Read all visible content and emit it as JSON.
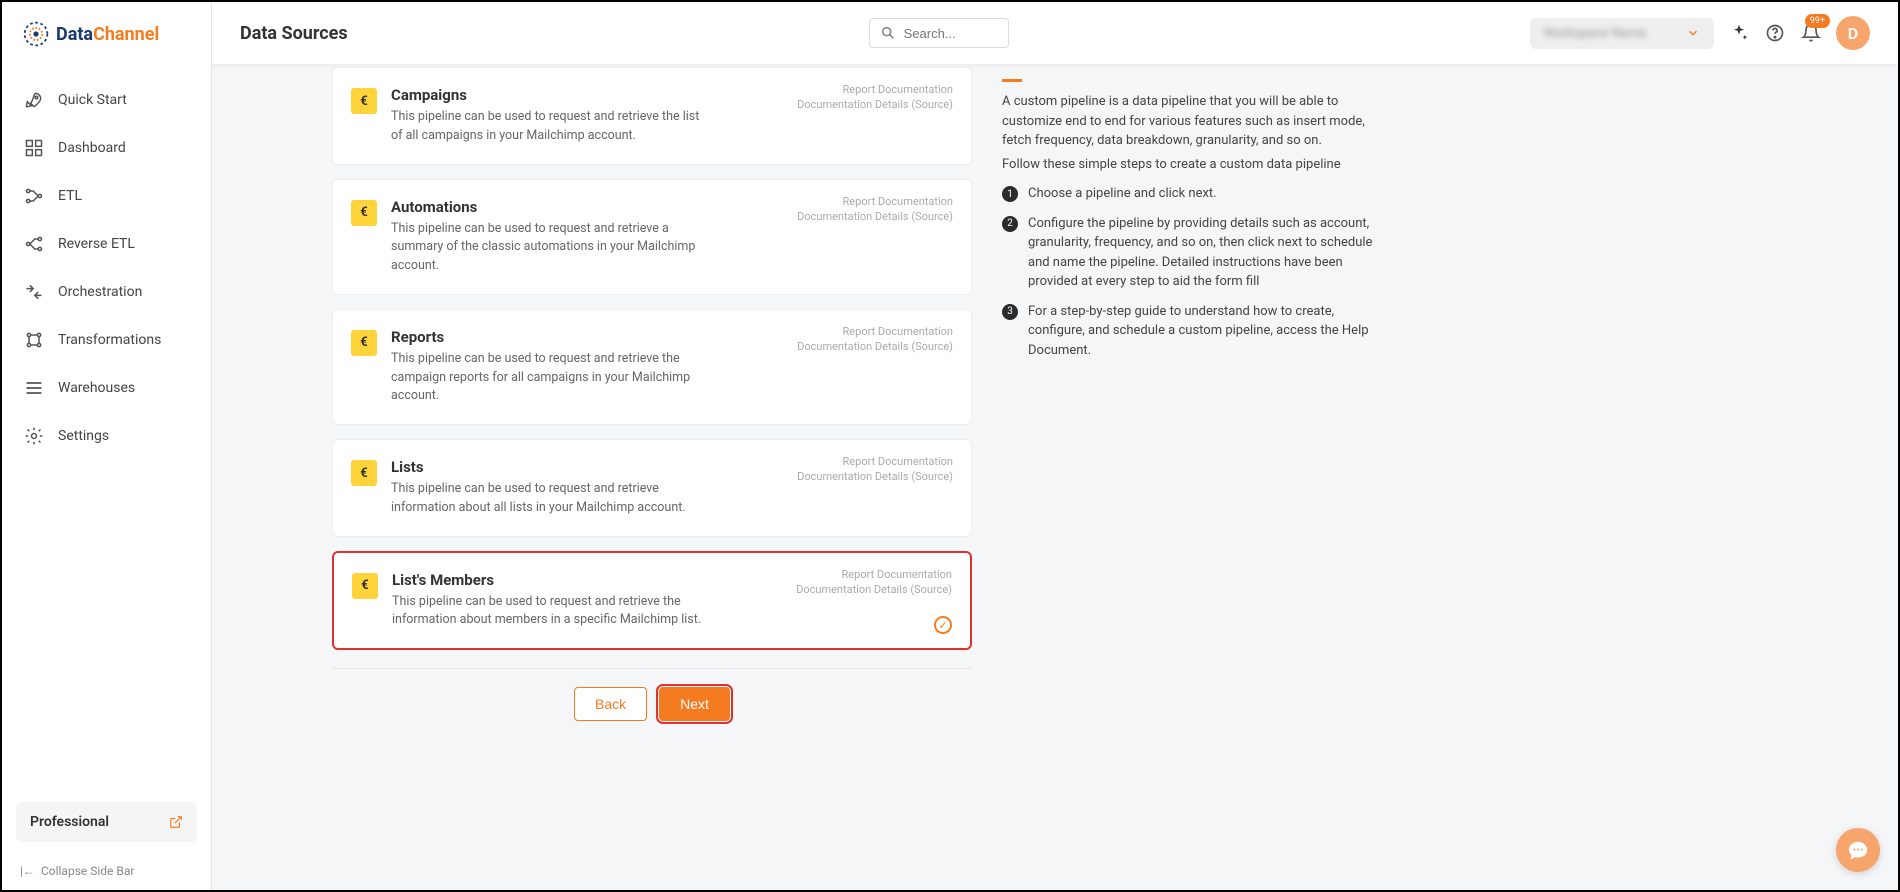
{
  "brand": {
    "part1": "Data",
    "part2": "Channel"
  },
  "header": {
    "title": "Data Sources",
    "search_placeholder": "Search...",
    "workspace_label": "Workspace Name",
    "notif_badge": "99+",
    "avatar_initial": "D"
  },
  "sidebar": {
    "items": [
      {
        "label": "Quick Start",
        "icon": "rocket"
      },
      {
        "label": "Dashboard",
        "icon": "grid"
      },
      {
        "label": "ETL",
        "icon": "flow"
      },
      {
        "label": "Reverse ETL",
        "icon": "reverse"
      },
      {
        "label": "Orchestration",
        "icon": "orchestration"
      },
      {
        "label": "Transformations",
        "icon": "transform"
      },
      {
        "label": "Warehouses",
        "icon": "list"
      },
      {
        "label": "Settings",
        "icon": "gear"
      }
    ],
    "plan": "Professional",
    "collapse": "Collapse Side Bar"
  },
  "pipelines": [
    {
      "title": "Campaigns",
      "desc": "This pipeline can be used to request and retrieve the list of all campaigns in your Mailchimp account.",
      "link1": "Report Documentation",
      "link2": "Documentation Details (Source)",
      "selected": false
    },
    {
      "title": "Automations",
      "desc": "This pipeline can be used to request and retrieve a summary of the classic automations in your Mailchimp account.",
      "link1": "Report Documentation",
      "link2": "Documentation Details (Source)",
      "selected": false
    },
    {
      "title": "Reports",
      "desc": "This pipeline can be used to request and retrieve the campaign reports for all campaigns in your Mailchimp account.",
      "link1": "Report Documentation",
      "link2": "Documentation Details (Source)",
      "selected": false
    },
    {
      "title": "Lists",
      "desc": "This pipeline can be used to request and retrieve information about all lists in your Mailchimp account.",
      "link1": "Report Documentation",
      "link2": "Documentation Details (Source)",
      "selected": false
    },
    {
      "title": "List's Members",
      "desc": "This pipeline can be used to request and retrieve the information about members in a specific Mailchimp list.",
      "link1": "Report Documentation",
      "link2": "Documentation Details (Source)",
      "selected": true
    }
  ],
  "buttons": {
    "back": "Back",
    "next": "Next"
  },
  "help": {
    "intro1": "A custom pipeline is a data pipeline that you will be able to customize end to end for various features such as insert mode, fetch frequency, data breakdown, granularity, and so on.",
    "intro2": "Follow these simple steps to create a custom data pipeline",
    "steps": [
      "Choose a pipeline and click next.",
      "Configure the pipeline by providing details such as account, granularity, frequency, and so on, then click next to schedule and name the pipeline. Detailed instructions have been provided at every step to aid the form fill",
      "For a step-by-step guide to understand how to create, configure, and schedule a custom pipeline, access the Help Document."
    ]
  }
}
